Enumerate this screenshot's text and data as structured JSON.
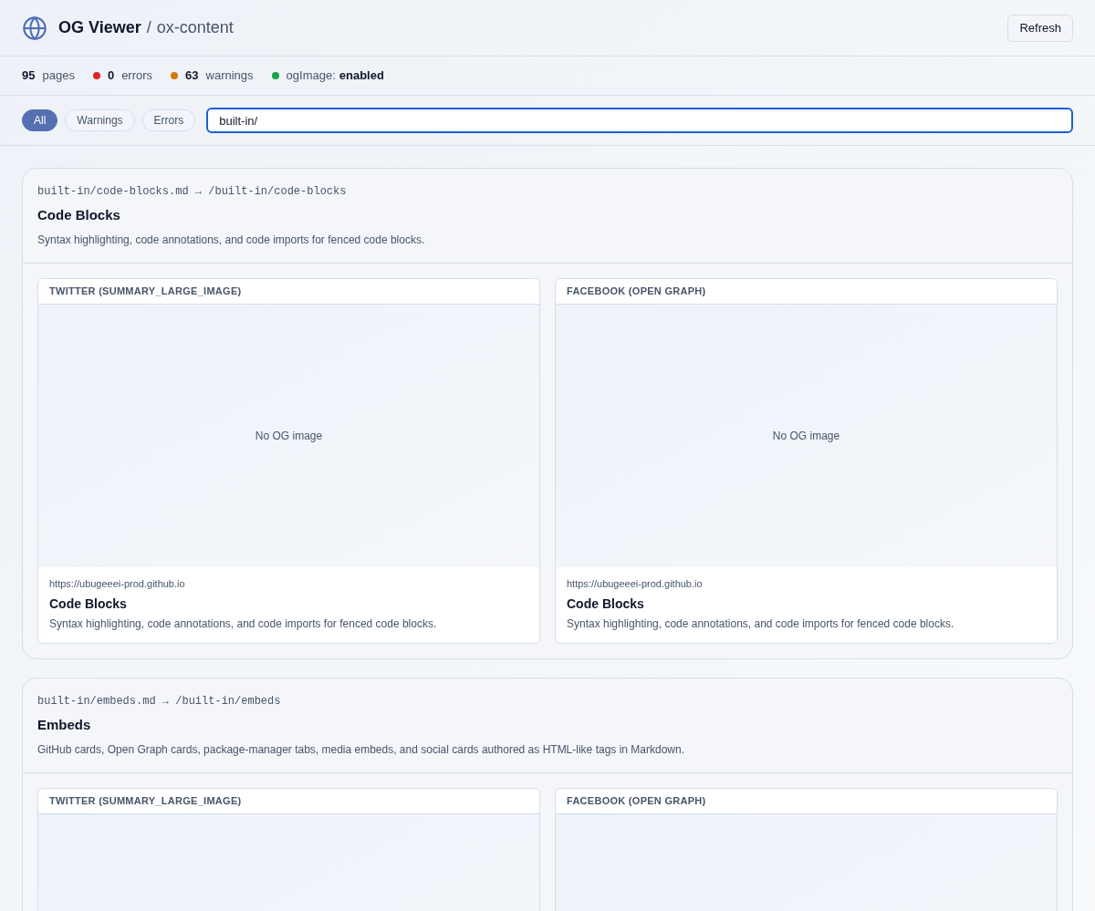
{
  "header": {
    "title": "OG Viewer",
    "separator": "/",
    "project": "ox-content",
    "refresh_button": "Refresh"
  },
  "stats": [
    {
      "kind": "count",
      "value": "95",
      "label": "pages"
    },
    {
      "kind": "count",
      "value": "0",
      "label": "errors",
      "color": "#dc2626"
    },
    {
      "kind": "count",
      "value": "63",
      "label": "warnings",
      "color": "#d97706"
    },
    {
      "kind": "setting",
      "label": "ogImage:",
      "value": "enabled",
      "color": "#16a34a"
    }
  ],
  "filters": [
    {
      "label": "All",
      "selected": true
    },
    {
      "label": "Warnings",
      "selected": false
    },
    {
      "label": "Errors",
      "selected": false
    }
  ],
  "search": {
    "value": "built-in/"
  },
  "pages": [
    {
      "source": "built-in/code-blocks.md → /built-in/code-blocks",
      "title": "Code Blocks",
      "description": "Syntax highlighting, code annotations, and code imports for fenced code blocks.",
      "previews": [
        {
          "platform": "TWITTER (SUMMARY_LARGE_IMAGE)",
          "image_text": "No OG image",
          "url": "https://ubugeeei-prod.github.io",
          "title": "Code Blocks",
          "description": "Syntax highlighting, code annotations, and code imports for fenced code blocks."
        },
        {
          "platform": "FACEBOOK (OPEN GRAPH)",
          "image_text": "No OG image",
          "url": "https://ubugeeei-prod.github.io",
          "title": "Code Blocks",
          "description": "Syntax highlighting, code annotations, and code imports for fenced code blocks."
        }
      ]
    },
    {
      "source": "built-in/embeds.md → /built-in/embeds",
      "title": "Embeds",
      "description": "GitHub cards, Open Graph cards, package-manager tabs, media embeds, and social cards authored as HTML-like tags in Markdown.",
      "previews": [
        {
          "platform": "TWITTER (SUMMARY_LARGE_IMAGE)"
        },
        {
          "platform": "FACEBOOK (OPEN GRAPH)"
        }
      ]
    }
  ]
}
